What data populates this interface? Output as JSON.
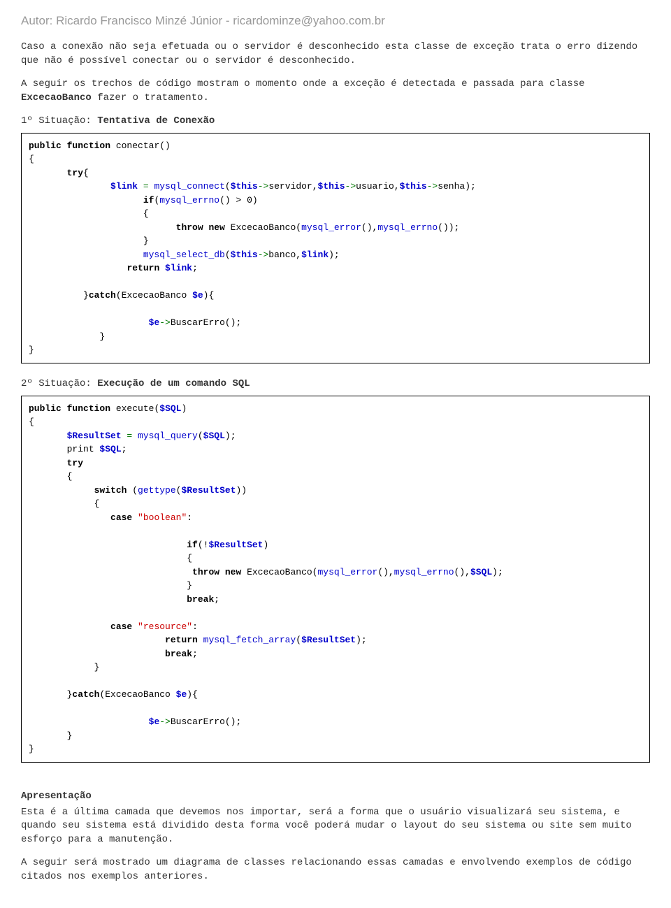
{
  "author": "Autor: Ricardo Francisco Minzé Júnior - ricardominze@yahoo.com.br",
  "p1": "Caso a conexão não seja efetuada ou o servidor é desconhecido esta classe de exceção trata o erro dizendo que não é possível conectar ou o servidor é desconhecido.",
  "p2_a": "A seguir os trechos de código mostram o momento onde a exceção é detectada e passada para classe ",
  "p2_b": "ExcecaoBanco",
  "p2_c": " fazer o tratamento.",
  "sit1_a": "1º Situação: ",
  "sit1_b": "Tentativa de Conexão",
  "sit2_a": "2º Situação: ",
  "sit2_b": "Execução de um comando SQL",
  "heading": "Apresentação",
  "p3": "Esta é a última camada que devemos nos importar, será a forma que o usuário visualizará seu sistema, e quando seu sistema está dividido desta forma você poderá mudar o layout do seu sistema ou site sem muito esforço para a manutenção.",
  "p4": "A seguir será mostrado um diagrama de classes relacionando essas camadas e envolvendo exemplos de código citados nos exemplos anteriores.",
  "code1": {
    "l1_kw1": "public function",
    "l1_fn": " conectar",
    "l1_p": "()",
    "l2": "{",
    "l3_kw": "try",
    "l3_p": "{",
    "l4_var": "$link",
    "l4_op": " = ",
    "l4_fn": "mysql_connect",
    "l4_p1": "(",
    "l4_v2": "$this",
    "l4_op2": "->",
    "l4_t1": "servidor,",
    "l4_v3": "$this",
    "l4_op3": "->",
    "l4_t2": "usuario,",
    "l4_v4": "$this",
    "l4_op4": "->",
    "l4_t3": "senha);",
    "l5_kw": "if",
    "l5_p1": "(",
    "l5_fn": "mysql_errno",
    "l5_p2": "() > 0)",
    "l6": "{",
    "l7_kw": "throw new",
    "l7_t": " ExcecaoBanco(",
    "l7_fn1": "mysql_error",
    "l7_p1": "(),",
    "l7_fn2": "mysql_errno",
    "l7_p2": "());",
    "l8": "}",
    "l9_fn": "mysql_select_db",
    "l9_p1": "(",
    "l9_v1": "$this",
    "l9_op": "->",
    "l9_t": "banco,",
    "l9_v2": "$link",
    "l9_p2": ");",
    "l10_kw": "return ",
    "l10_v": "$link",
    "l10_p": ";",
    "l11_p1": "}",
    "l11_kw": "catch",
    "l11_p2": "(ExcecaoBanco ",
    "l11_v": "$e",
    "l11_p3": "){",
    "l12_v": "$e",
    "l12_op": "->",
    "l12_t": "BuscarErro();",
    "l13": "}",
    "l14": "}"
  },
  "code2": {
    "l1_kw": "public function",
    "l1_fn": " execute",
    "l1_p1": "(",
    "l1_v": "$SQL",
    "l1_p2": ")",
    "l2": "{",
    "l3_v1": "$ResultSet",
    "l3_op": " = ",
    "l3_fn": "mysql_query",
    "l3_p1": "(",
    "l3_v2": "$SQL",
    "l3_p2": ");",
    "l4_t": "print ",
    "l4_v": "$SQL",
    "l4_p": ";",
    "l5_kw": "try",
    "l6": "{",
    "l7_kw": "switch ",
    "l7_p1": "(",
    "l7_fn": "gettype",
    "l7_p2": "(",
    "l7_v": "$ResultSet",
    "l7_p3": "))",
    "l8": "{",
    "l9_kw": "case ",
    "l9_s": "\"boolean\"",
    "l9_p": ":",
    "l10_kw": "if",
    "l10_p1": "(!",
    "l10_v": "$ResultSet",
    "l10_p2": ")",
    "l11": "{",
    "l12_kw": "throw new",
    "l12_t": " ExcecaoBanco(",
    "l12_fn1": "mysql_error",
    "l12_p1": "(),",
    "l12_fn2": "mysql_errno",
    "l12_p2": "(),",
    "l12_v": "$SQL",
    "l12_p3": ");",
    "l13": "}",
    "l14_kw": "break",
    "l14_p": ";",
    "l15_kw": "case ",
    "l15_s": "\"resource\"",
    "l15_p": ":",
    "l16_kw": "return ",
    "l16_fn": "mysql_fetch_array",
    "l16_p1": "(",
    "l16_v": "$ResultSet",
    "l16_p2": ");",
    "l17_kw": "break",
    "l17_p": ";",
    "l18": "}",
    "l19_p1": "}",
    "l19_kw": "catch",
    "l19_p2": "(ExcecaoBanco ",
    "l19_v": "$e",
    "l19_p3": "){",
    "l20_v": "$e",
    "l20_op": "->",
    "l20_t": "BuscarErro();",
    "l21": "}",
    "l22": "}"
  }
}
